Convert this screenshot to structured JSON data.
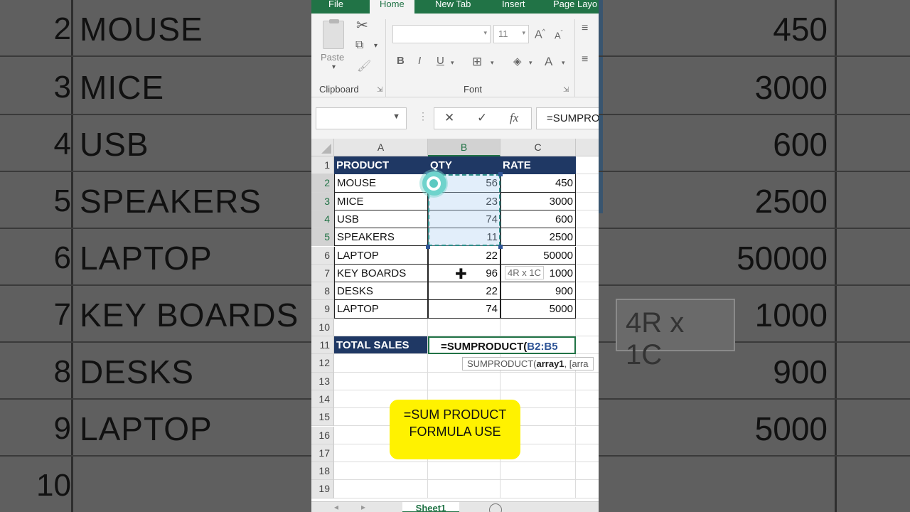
{
  "ribbon": {
    "tabs": [
      "File",
      "Home",
      "New Tab",
      "Insert",
      "Page Layo"
    ],
    "active_tab": "Home",
    "clipboard_label": "Clipboard",
    "paste_label": "Paste",
    "font_label": "Font",
    "font_size": "11",
    "bold": "B",
    "italic": "I",
    "underline": "U",
    "font_color_glyph": "A",
    "grow_font": "A",
    "shrink_font": "A"
  },
  "formula_bar": {
    "cancel": "✕",
    "enter": "✓",
    "fx": "fx",
    "formula": "=SUMPRODC"
  },
  "columns": [
    "A",
    "B",
    "C"
  ],
  "rows": [
    "1",
    "2",
    "3",
    "4",
    "5",
    "6",
    "7",
    "8",
    "9",
    "10",
    "11",
    "12",
    "13",
    "14",
    "15",
    "16",
    "17",
    "18",
    "19"
  ],
  "table": {
    "headers": [
      "PRODUCT",
      "QTY",
      "RATE"
    ],
    "data": [
      {
        "product": "MOUSE",
        "qty": "56",
        "rate": "450"
      },
      {
        "product": "MICE",
        "qty": "23",
        "rate": "3000"
      },
      {
        "product": "USB",
        "qty": "74",
        "rate": "600"
      },
      {
        "product": "SPEAKERS",
        "qty": "11",
        "rate": "2500"
      },
      {
        "product": "LAPTOP",
        "qty": "22",
        "rate": "50000"
      },
      {
        "product": "KEY BOARDS",
        "qty": "96",
        "rate": "1000"
      },
      {
        "product": "DESKS",
        "qty": "22",
        "rate": "900"
      },
      {
        "product": "LAPTOP",
        "qty": "74",
        "rate": "5000"
      }
    ],
    "total_label": "TOTAL SALES",
    "formula_prefix": "=SUMPRODUCT(",
    "formula_range": "B2:B5"
  },
  "size_tip": "4R x 1C",
  "fn_tooltip": {
    "name": "SUMPRODUCT(",
    "arg1": "array1",
    "rest": ", [arra"
  },
  "callout": {
    "line1": "=SUM PRODUCT",
    "line2": "FORMULA USE"
  },
  "sheet": {
    "tab": "Sheet1"
  },
  "background_zoom": {
    "rows": [
      {
        "num": "2",
        "name": "MOUSE",
        "value": "450"
      },
      {
        "num": "3",
        "name": "MICE",
        "value": "3000"
      },
      {
        "num": "4",
        "name": "USB",
        "value": "600"
      },
      {
        "num": "5",
        "name": "SPEAKERS",
        "value": "2500"
      },
      {
        "num": "6",
        "name": "LAPTOP",
        "value": "50000"
      },
      {
        "num": "7",
        "name": "KEY BOARDS",
        "value": "1000"
      },
      {
        "num": "8",
        "name": "DESKS",
        "value": "900"
      },
      {
        "num": "9",
        "name": "LAPTOP",
        "value": "5000"
      },
      {
        "num": "10",
        "name": "",
        "value": ""
      }
    ],
    "tip": "4R x 1C"
  },
  "colors": {
    "header_fill": "#1f3864",
    "excel_green": "#217346",
    "callout_yellow": "#fff200"
  }
}
